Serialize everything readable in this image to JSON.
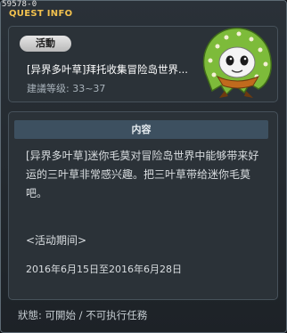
{
  "window": {
    "quest_id": "59578-0",
    "title": "QUEST INFO"
  },
  "summary": {
    "category_badge": "活動",
    "quest_name": "[异界多叶草]拜托收集冒险岛世界...",
    "recommended_level": "建議等级: 33~37"
  },
  "npc": {
    "name": "mini-furry-npc",
    "hood_color": "#7dbb3a",
    "face_color": "#f4f4f4",
    "accent_color": "#c06a1d"
  },
  "content": {
    "header": "内容",
    "description": "[异界多叶草]迷你毛莫对冒险岛世界中能够带来好运的三叶草非常感兴趣。把三叶草带给迷你毛莫吧。",
    "period_label": "<活动期间>",
    "period_dates": "2016年6月15日至2016年6月28日"
  },
  "footer": {
    "status": "狀態:  可開始  /  不可执行任務"
  }
}
